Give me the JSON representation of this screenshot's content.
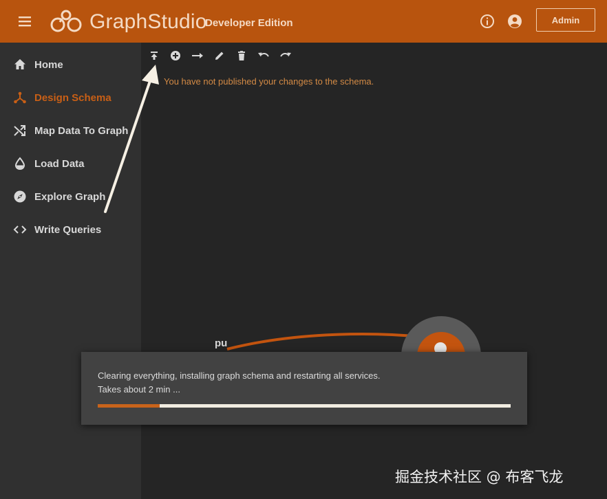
{
  "header": {
    "brand": "GraphStudio",
    "edition": "Developer Edition",
    "admin_label": "Admin",
    "accent_color": "#b8540e"
  },
  "sidebar": {
    "items": [
      {
        "label": "Home",
        "icon": "home-icon",
        "active": false
      },
      {
        "label": "Design Schema",
        "icon": "schema-icon",
        "active": true
      },
      {
        "label": "Map Data To Graph",
        "icon": "shuffle-icon",
        "active": false
      },
      {
        "label": "Load Data",
        "icon": "drop-icon",
        "active": false
      },
      {
        "label": "Explore Graph",
        "icon": "compass-icon",
        "active": false
      },
      {
        "label": "Write Queries",
        "icon": "code-icon",
        "active": false
      }
    ]
  },
  "toolbar": {
    "icons": [
      "publish-icon",
      "add-vertex-icon",
      "add-edge-icon",
      "edit-icon",
      "delete-icon",
      "undo-icon",
      "redo-icon"
    ]
  },
  "main": {
    "warning": "You have not published your changes to the schema."
  },
  "canvas": {
    "edge_label": "pu"
  },
  "dialog": {
    "message": "Clearing everything, installing graph schema and restarting all services.",
    "eta": "Takes about 2 min ...",
    "progress": 0.15
  },
  "watermark": "掘金技术社区 @ 布客飞龙"
}
